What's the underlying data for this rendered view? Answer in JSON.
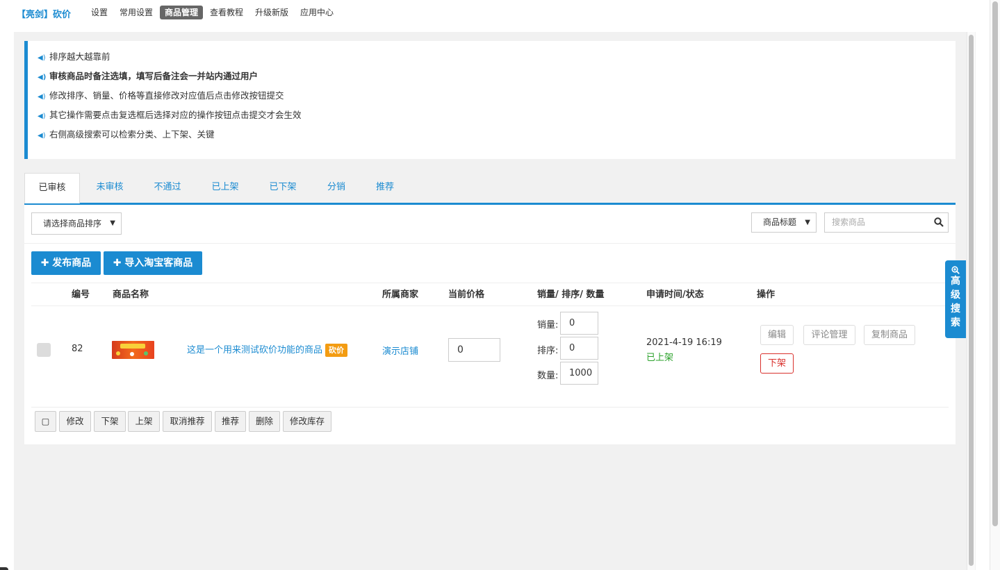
{
  "brand": "【亮剑】砍价",
  "nav": [
    "设置",
    "常用设置",
    "商品管理",
    "查看教程",
    "升级新版",
    "应用中心"
  ],
  "nav_active_index": 2,
  "tips": [
    "排序越大越靠前",
    "审核商品时备注选填，填写后备注会一并站内通过用户",
    "修改排序、销量、价格等直接修改对应值后点击修改按钮提交",
    "其它操作需要点击复选框后选择对应的操作按钮点击提交才会生效",
    "右侧高级搜索可以检索分类、上下架、关键"
  ],
  "tabs": [
    "已审核",
    "未审核",
    "不通过",
    "已上架",
    "已下架",
    "分销",
    "推荐"
  ],
  "tab_active_index": 0,
  "toolbar": {
    "sort_select": "请选择商品排序",
    "field_select": "商品标题",
    "search_placeholder": "搜索商品"
  },
  "actions": {
    "publish": "✚ 发布商品",
    "import": "✚ 导入淘宝客商品"
  },
  "table": {
    "headers": {
      "id": "编号",
      "name": "商品名称",
      "merchant": "所属商家",
      "price": "当前价格",
      "stats": "销量/ 排序/ 数量",
      "time_status": "申请时间/状态",
      "ops": "操作"
    },
    "rows": [
      {
        "id": "82",
        "thumb_text": "全民来砍价",
        "name": "这是一个用来测试砍价功能的商品",
        "badge": "砍价",
        "merchant": "演示店铺",
        "price": "0",
        "sales_label": "销量:",
        "sales": "0",
        "sort_label": "排序:",
        "sort": "0",
        "qty_label": "数量:",
        "qty": "1000",
        "time": "2021-4-19 16:19",
        "status": "已上架",
        "ops": [
          "编辑",
          "评论管理",
          "复制商品",
          "下架"
        ]
      }
    ]
  },
  "bulk": [
    "▢",
    "修改",
    "下架",
    "上架",
    "取消推荐",
    "推荐",
    "删除",
    "修改库存"
  ],
  "advanced_search": "高级搜索",
  "colors": {
    "accent": "#1b8bd1",
    "badge": "#f39c12",
    "status_ok": "#2aa12a",
    "danger": "#d9302c"
  }
}
